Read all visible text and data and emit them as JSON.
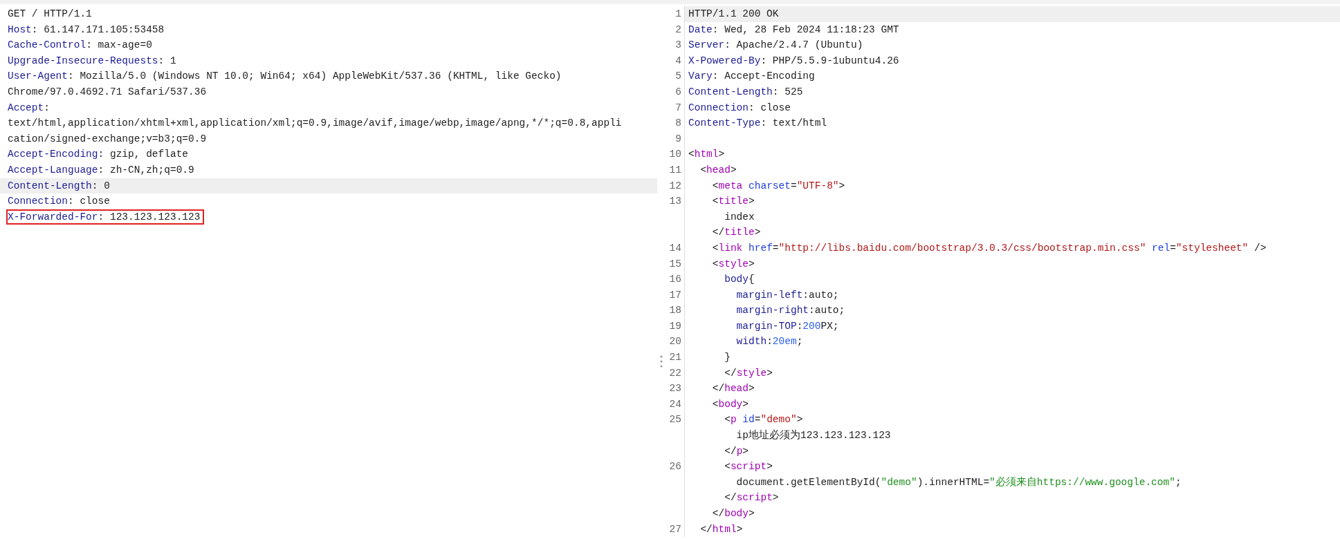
{
  "request": {
    "lines": [
      {
        "highlighted": false,
        "marked": false,
        "tokens": [
          {
            "kind": "plain",
            "text": "GET / HTTP/1.1"
          }
        ]
      },
      {
        "highlighted": false,
        "marked": false,
        "tokens": [
          {
            "kind": "key",
            "text": "Host"
          },
          {
            "kind": "plain",
            "text": ": 61.147.171.105:53458"
          }
        ]
      },
      {
        "highlighted": false,
        "marked": false,
        "tokens": [
          {
            "kind": "key",
            "text": "Cache-Control"
          },
          {
            "kind": "plain",
            "text": ": max-age=0"
          }
        ]
      },
      {
        "highlighted": false,
        "marked": false,
        "tokens": [
          {
            "kind": "key",
            "text": "Upgrade-Insecure-Requests"
          },
          {
            "kind": "plain",
            "text": ": 1"
          }
        ]
      },
      {
        "highlighted": false,
        "marked": false,
        "tokens": [
          {
            "kind": "key",
            "text": "User-Agent"
          },
          {
            "kind": "plain",
            "text": ": Mozilla/5.0 (Windows NT 10.0; Win64; x64) AppleWebKit/537.36 (KHTML, like Gecko)"
          }
        ]
      },
      {
        "highlighted": false,
        "marked": false,
        "tokens": [
          {
            "kind": "plain",
            "text": "Chrome/97.0.4692.71 Safari/537.36"
          }
        ]
      },
      {
        "highlighted": false,
        "marked": false,
        "tokens": [
          {
            "kind": "key",
            "text": "Accept"
          },
          {
            "kind": "plain",
            "text": ":"
          }
        ]
      },
      {
        "highlighted": false,
        "marked": false,
        "tokens": [
          {
            "kind": "plain",
            "text": "text/html,application/xhtml+xml,application/xml;q=0.9,image/avif,image/webp,image/apng,*/*;q=0.8,appli"
          }
        ]
      },
      {
        "highlighted": false,
        "marked": false,
        "tokens": [
          {
            "kind": "plain",
            "text": "cation/signed-exchange;v=b3;q=0.9"
          }
        ]
      },
      {
        "highlighted": false,
        "marked": false,
        "tokens": [
          {
            "kind": "key",
            "text": "Accept-Encoding"
          },
          {
            "kind": "plain",
            "text": ": gzip, deflate"
          }
        ]
      },
      {
        "highlighted": false,
        "marked": false,
        "tokens": [
          {
            "kind": "key",
            "text": "Accept-Language"
          },
          {
            "kind": "plain",
            "text": ": zh-CN,zh;q=0.9"
          }
        ]
      },
      {
        "highlighted": true,
        "marked": false,
        "tokens": [
          {
            "kind": "key",
            "text": "Content-Length"
          },
          {
            "kind": "plain",
            "text": ": 0"
          }
        ]
      },
      {
        "highlighted": false,
        "marked": false,
        "tokens": [
          {
            "kind": "key",
            "text": "Connection"
          },
          {
            "kind": "plain",
            "text": ": close"
          }
        ]
      },
      {
        "highlighted": false,
        "marked": true,
        "tokens": [
          {
            "kind": "key",
            "text": "X-Forwarded-For"
          },
          {
            "kind": "plain",
            "text": ": 123.123.123.123"
          }
        ]
      }
    ]
  },
  "response": {
    "lines": [
      {
        "number": "1",
        "highlighted": true,
        "tokens": [
          {
            "kind": "plain",
            "text": "HTTP/1.1 200 OK"
          }
        ]
      },
      {
        "number": "2",
        "highlighted": false,
        "tokens": [
          {
            "kind": "key",
            "text": "Date"
          },
          {
            "kind": "plain",
            "text": ": Wed, 28 Feb 2024 11:18:23 GMT"
          }
        ]
      },
      {
        "number": "3",
        "highlighted": false,
        "tokens": [
          {
            "kind": "key",
            "text": "Server"
          },
          {
            "kind": "plain",
            "text": ": Apache/2.4.7 (Ubuntu)"
          }
        ]
      },
      {
        "number": "4",
        "highlighted": false,
        "tokens": [
          {
            "kind": "key",
            "text": "X-Powered-By"
          },
          {
            "kind": "plain",
            "text": ": PHP/5.5.9-1ubuntu4.26"
          }
        ]
      },
      {
        "number": "5",
        "highlighted": false,
        "tokens": [
          {
            "kind": "key",
            "text": "Vary"
          },
          {
            "kind": "plain",
            "text": ": Accept-Encoding"
          }
        ]
      },
      {
        "number": "6",
        "highlighted": false,
        "tokens": [
          {
            "kind": "key",
            "text": "Content-Length"
          },
          {
            "kind": "plain",
            "text": ": 525"
          }
        ]
      },
      {
        "number": "7",
        "highlighted": false,
        "tokens": [
          {
            "kind": "key",
            "text": "Connection"
          },
          {
            "kind": "plain",
            "text": ": close"
          }
        ]
      },
      {
        "number": "8",
        "highlighted": false,
        "tokens": [
          {
            "kind": "key",
            "text": "Content-Type"
          },
          {
            "kind": "plain",
            "text": ": text/html"
          }
        ]
      },
      {
        "number": "9",
        "highlighted": false
      },
      {
        "number": "10",
        "highlighted": false,
        "tokens": [
          {
            "kind": "plain",
            "text": "<"
          },
          {
            "kind": "tag",
            "text": "html"
          },
          {
            "kind": "plain",
            "text": ">"
          }
        ]
      },
      {
        "number": "11",
        "highlighted": false,
        "tokens": [
          {
            "kind": "plain",
            "text": "  <"
          },
          {
            "kind": "tag",
            "text": "head"
          },
          {
            "kind": "plain",
            "text": ">"
          }
        ]
      },
      {
        "number": "12",
        "highlighted": false,
        "tokens": [
          {
            "kind": "plain",
            "text": "    <"
          },
          {
            "kind": "tag",
            "text": "meta"
          },
          {
            "kind": "attr",
            "text": " charset"
          },
          {
            "kind": "plain",
            "text": "="
          },
          {
            "kind": "string",
            "text": "\"UTF-8\""
          },
          {
            "kind": "plain",
            "text": ">"
          }
        ]
      },
      {
        "number": "13",
        "highlighted": false,
        "tokens": [
          {
            "kind": "plain",
            "text": "    <"
          },
          {
            "kind": "tag",
            "text": "title"
          },
          {
            "kind": "plain",
            "text": ">"
          }
        ]
      },
      {
        "highlighted": false,
        "tokens": [
          {
            "kind": "plain",
            "text": "      index"
          }
        ]
      },
      {
        "highlighted": false,
        "tokens": [
          {
            "kind": "plain",
            "text": "    </"
          },
          {
            "kind": "tag",
            "text": "title"
          },
          {
            "kind": "plain",
            "text": ">"
          }
        ]
      },
      {
        "number": "14",
        "highlighted": false,
        "tokens": [
          {
            "kind": "plain",
            "text": "    <"
          },
          {
            "kind": "tag",
            "text": "link"
          },
          {
            "kind": "attr",
            "text": " href"
          },
          {
            "kind": "plain",
            "text": "="
          },
          {
            "kind": "string",
            "text": "\"http://libs.baidu.com/bootstrap/3.0.3/css/bootstrap.min.css\""
          },
          {
            "kind": "attr",
            "text": " rel"
          },
          {
            "kind": "plain",
            "text": "="
          },
          {
            "kind": "string",
            "text": "\"stylesheet\""
          },
          {
            "kind": "plain",
            "text": " />"
          }
        ]
      },
      {
        "number": "15",
        "highlighted": false,
        "tokens": [
          {
            "kind": "plain",
            "text": "    <"
          },
          {
            "kind": "tag",
            "text": "style"
          },
          {
            "kind": "plain",
            "text": ">"
          }
        ]
      },
      {
        "number": "16",
        "highlighted": false,
        "tokens": [
          {
            "kind": "prop",
            "text": "      body"
          },
          {
            "kind": "plain",
            "text": "{"
          }
        ]
      },
      {
        "number": "17",
        "highlighted": false,
        "tokens": [
          {
            "kind": "prop",
            "text": "        margin-left"
          },
          {
            "kind": "plain",
            "text": ":auto;"
          }
        ]
      },
      {
        "number": "18",
        "highlighted": false,
        "tokens": [
          {
            "kind": "prop",
            "text": "        margin-right"
          },
          {
            "kind": "plain",
            "text": ":auto;"
          }
        ]
      },
      {
        "number": "19",
        "highlighted": false,
        "tokens": [
          {
            "kind": "prop",
            "text": "        margin-TOP"
          },
          {
            "kind": "plain",
            "text": ":"
          },
          {
            "kind": "number",
            "text": "200"
          },
          {
            "kind": "plain",
            "text": "PX;"
          }
        ]
      },
      {
        "number": "20",
        "highlighted": false,
        "tokens": [
          {
            "kind": "prop",
            "text": "        width"
          },
          {
            "kind": "plain",
            "text": ":"
          },
          {
            "kind": "number",
            "text": "20em"
          },
          {
            "kind": "plain",
            "text": ";"
          }
        ]
      },
      {
        "number": "21",
        "highlighted": false,
        "tokens": [
          {
            "kind": "plain",
            "text": "      }"
          }
        ]
      },
      {
        "number": "22",
        "highlighted": false,
        "tokens": [
          {
            "kind": "plain",
            "text": "      </"
          },
          {
            "kind": "tag",
            "text": "style"
          },
          {
            "kind": "plain",
            "text": ">"
          }
        ]
      },
      {
        "number": "23",
        "highlighted": false,
        "tokens": [
          {
            "kind": "plain",
            "text": "    </"
          },
          {
            "kind": "tag",
            "text": "head"
          },
          {
            "kind": "plain",
            "text": ">"
          }
        ]
      },
      {
        "number": "24",
        "highlighted": false,
        "tokens": [
          {
            "kind": "plain",
            "text": "    <"
          },
          {
            "kind": "tag",
            "text": "body"
          },
          {
            "kind": "plain",
            "text": ">"
          }
        ]
      },
      {
        "number": "25",
        "highlighted": false,
        "tokens": [
          {
            "kind": "plain",
            "text": "      <"
          },
          {
            "kind": "tag",
            "text": "p"
          },
          {
            "kind": "attr",
            "text": " id"
          },
          {
            "kind": "plain",
            "text": "="
          },
          {
            "kind": "string",
            "text": "\"demo\""
          },
          {
            "kind": "plain",
            "text": ">"
          }
        ]
      },
      {
        "highlighted": false,
        "tokens": [
          {
            "kind": "plain",
            "text": "        ip地址必须为123.123.123.123"
          }
        ]
      },
      {
        "highlighted": false,
        "tokens": [
          {
            "kind": "plain",
            "text": "      </"
          },
          {
            "kind": "tag",
            "text": "p"
          },
          {
            "kind": "plain",
            "text": ">"
          }
        ]
      },
      {
        "number": "26",
        "highlighted": false,
        "tokens": [
          {
            "kind": "plain",
            "text": "      <"
          },
          {
            "kind": "tag",
            "text": "script"
          },
          {
            "kind": "plain",
            "text": ">"
          }
        ]
      },
      {
        "highlighted": false,
        "tokens": [
          {
            "kind": "plain",
            "text": "        document.getElementById("
          },
          {
            "kind": "js-string",
            "text": "\"demo\""
          },
          {
            "kind": "plain",
            "text": ").innerHTML="
          },
          {
            "kind": "js-string",
            "text": "\"必须来自https://www.google.com\""
          },
          {
            "kind": "plain",
            "text": ";"
          }
        ]
      },
      {
        "highlighted": false,
        "tokens": [
          {
            "kind": "plain",
            "text": "      </"
          },
          {
            "kind": "tag",
            "text": "script"
          },
          {
            "kind": "plain",
            "text": ">"
          }
        ]
      },
      {
        "highlighted": false,
        "tokens": [
          {
            "kind": "plain",
            "text": "    </"
          },
          {
            "kind": "tag",
            "text": "body"
          },
          {
            "kind": "plain",
            "text": ">"
          }
        ]
      },
      {
        "number": "27",
        "highlighted": false,
        "tokens": [
          {
            "kind": "plain",
            "text": "  </"
          },
          {
            "kind": "tag",
            "text": "html"
          },
          {
            "kind": "plain",
            "text": ">"
          }
        ]
      }
    ]
  }
}
